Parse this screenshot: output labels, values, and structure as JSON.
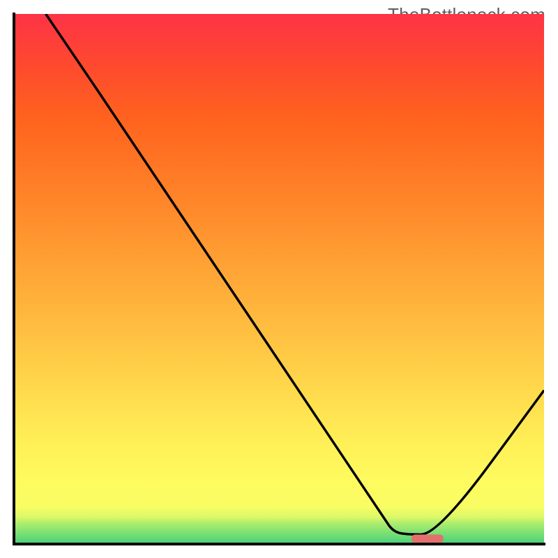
{
  "watermark": "TheBottleneck.com",
  "chart_data": {
    "type": "line",
    "title": "",
    "xlabel": "",
    "ylabel": "",
    "xlim": [
      0,
      100
    ],
    "ylim": [
      0,
      100
    ],
    "gradient_stops": [
      {
        "offset": 0,
        "color": "#44d17b"
      },
      {
        "offset": 2,
        "color": "#79df74"
      },
      {
        "offset": 4,
        "color": "#b0ee6d"
      },
      {
        "offset": 5,
        "color": "#d9f868"
      },
      {
        "offset": 7,
        "color": "#f8fd63"
      },
      {
        "offset": 12,
        "color": "#fefb5f"
      },
      {
        "offset": 20,
        "color": "#ffee56"
      },
      {
        "offset": 35,
        "color": "#ffcb46"
      },
      {
        "offset": 50,
        "color": "#ffa837"
      },
      {
        "offset": 65,
        "color": "#ff8529"
      },
      {
        "offset": 80,
        "color": "#ff631e"
      },
      {
        "offset": 90,
        "color": "#fe4a2d"
      },
      {
        "offset": 100,
        "color": "#fd3346"
      }
    ],
    "series": [
      {
        "name": "bottleneck-curve",
        "type": "line",
        "points": [
          {
            "x": 6.0,
            "y": 100.0
          },
          {
            "x": 26.0,
            "y": 70.5
          },
          {
            "x": 70.0,
            "y": 4.5
          },
          {
            "x": 71.5,
            "y": 2.5
          },
          {
            "x": 73.5,
            "y": 1.8
          },
          {
            "x": 80.0,
            "y": 1.8
          },
          {
            "x": 100.0,
            "y": 29.0
          }
        ]
      }
    ],
    "marker": {
      "name": "optimal-range",
      "x_start": 75.0,
      "x_end": 81.0,
      "y": 1.0,
      "color": "#e4706c"
    },
    "axes": {
      "color": "#000000",
      "width": 4
    }
  }
}
